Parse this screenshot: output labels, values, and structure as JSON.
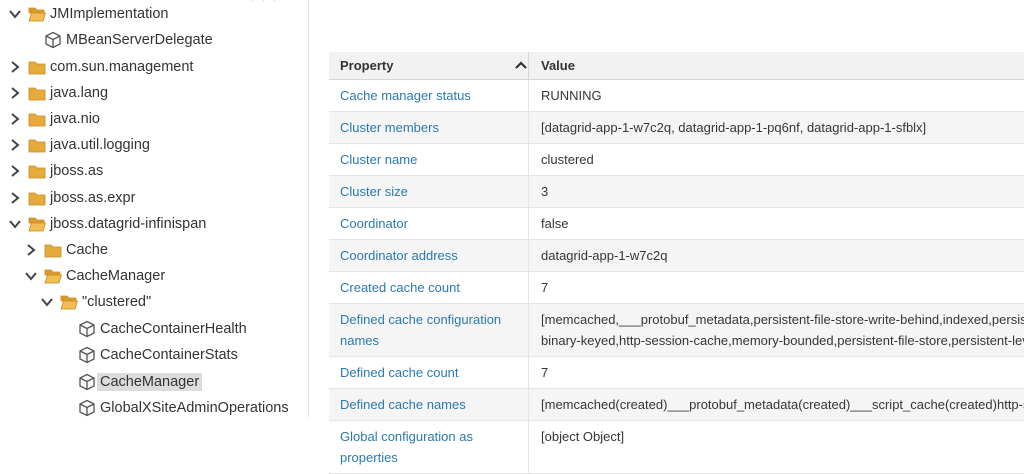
{
  "tree": {
    "top_dots": "· · ·",
    "nodes": [
      {
        "label": "JMImplementation",
        "type": "folder-open",
        "expanded": true
      },
      {
        "label": "MBeanServerDelegate",
        "type": "mbean"
      },
      {
        "label": "com.sun.management",
        "type": "folder",
        "expanded": false
      },
      {
        "label": "java.lang",
        "type": "folder",
        "expanded": false
      },
      {
        "label": "java.nio",
        "type": "folder",
        "expanded": false
      },
      {
        "label": "java.util.logging",
        "type": "folder",
        "expanded": false
      },
      {
        "label": "jboss.as",
        "type": "folder",
        "expanded": false
      },
      {
        "label": "jboss.as.expr",
        "type": "folder",
        "expanded": false
      },
      {
        "label": "jboss.datagrid-infinispan",
        "type": "folder-open",
        "expanded": true
      },
      {
        "label": "Cache",
        "type": "folder",
        "expanded": false
      },
      {
        "label": "CacheManager",
        "type": "folder-open",
        "expanded": true
      },
      {
        "label": "\"clustered\"",
        "type": "folder-open",
        "expanded": true
      },
      {
        "label": "CacheContainerHealth",
        "type": "mbean"
      },
      {
        "label": "CacheContainerStats",
        "type": "mbean"
      },
      {
        "label": "CacheManager",
        "type": "mbean",
        "selected": true
      },
      {
        "label": "GlobalXSiteAdminOperations",
        "type": "mbean"
      }
    ]
  },
  "table": {
    "headers": {
      "property": "Property",
      "value": "Value"
    },
    "rows": [
      {
        "property": "Cache manager status",
        "value": "RUNNING"
      },
      {
        "property": "Cluster members",
        "value": "[datagrid-app-1-w7c2q, datagrid-app-1-pq6nf, datagrid-app-1-sfblx]"
      },
      {
        "property": "Cluster name",
        "value": "clustered"
      },
      {
        "property": "Cluster size",
        "value": "3"
      },
      {
        "property": "Coordinator",
        "value": "false"
      },
      {
        "property": "Coordinator address",
        "value": "datagrid-app-1-w7c2q"
      },
      {
        "property": "Created cache count",
        "value": "7"
      },
      {
        "property": "Defined cache configuration names",
        "property_lines": [
          "Defined cache configuration",
          "names"
        ],
        "value_lines": [
          "[memcached,___protobuf_metadata,persistent-file-store-write-behind,indexed,persistent-jdbc-string-keyed",
          "binary-keyed,http-session-cache,memory-bounded,persistent-file-store,persistent-level"
        ]
      },
      {
        "property": "Defined cache count",
        "value": "7"
      },
      {
        "property": "Defined cache names",
        "value": "[memcached(created)___protobuf_metadata(created)___script_cache(created)http-session-cache(created)"
      },
      {
        "property": "Global configuration as properties",
        "property_lines": [
          "Global configuration as",
          "properties"
        ],
        "value": "[object Object]"
      }
    ]
  },
  "colors": {
    "link": "#2a7ab0",
    "folder": "#e2a33a",
    "header_bg": "#f2f2f2",
    "selected_bg": "#dcdcdc"
  }
}
